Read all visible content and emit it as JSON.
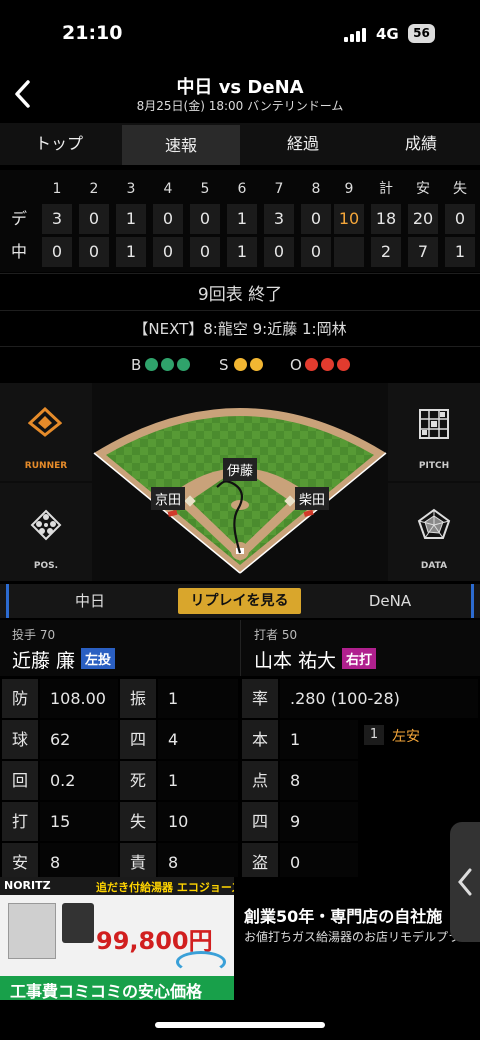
{
  "status": {
    "time": "21:10",
    "network": "4G",
    "battery": "56"
  },
  "header": {
    "title": "中日 vs DeNA",
    "subtitle": "8月25日(金) 18:00 バンテリンドーム"
  },
  "tabs": [
    "トップ",
    "速報",
    "経過",
    "成績"
  ],
  "scoreboard": {
    "headers": [
      "1",
      "2",
      "3",
      "4",
      "5",
      "6",
      "7",
      "8",
      "9",
      "計",
      "安",
      "失"
    ],
    "rows": [
      {
        "team": "デ",
        "cells": [
          "3",
          "0",
          "1",
          "0",
          "0",
          "1",
          "3",
          "0",
          "10",
          "18",
          "20",
          "0"
        ]
      },
      {
        "team": "中",
        "cells": [
          "0",
          "0",
          "1",
          "0",
          "0",
          "1",
          "0",
          "0",
          "",
          "2",
          "7",
          "1"
        ]
      }
    ]
  },
  "inning_status": "9回表 終了",
  "next_batters": "【NEXT】8:龍空 9:近藤 1:岡林",
  "bso": {
    "b_label": "B",
    "s_label": "S",
    "o_label": "O",
    "balls": 3,
    "strikes": 2,
    "outs": 3
  },
  "field": {
    "left_panel_top": "RUNNER",
    "left_panel_bottom": "POS.",
    "right_panel_top": "PITCH",
    "right_panel_bottom": "DATA",
    "fielders": {
      "center": "伊藤",
      "left": "京田",
      "right": "柴田"
    }
  },
  "team_bar": {
    "home": "中日",
    "replay": "リプレイを見る",
    "away": "DeNA"
  },
  "pitcher": {
    "tag": "投手  70",
    "name": "近藤 廉",
    "hand": "左投",
    "stats": [
      [
        "防",
        "108.00",
        "振",
        "1"
      ],
      [
        "球",
        "62",
        "四",
        "4"
      ],
      [
        "回",
        "0.2",
        "死",
        "1"
      ],
      [
        "打",
        "15",
        "失",
        "10"
      ],
      [
        "安",
        "8",
        "責",
        "8"
      ]
    ]
  },
  "batter": {
    "tag": "打者  50",
    "name": "山本 祐大",
    "hand": "右打",
    "stats": [
      [
        "率",
        ".280 (100-28)"
      ],
      [
        "本",
        "1"
      ],
      [
        "点",
        "8"
      ],
      [
        "四",
        "9"
      ],
      [
        "盗",
        "0"
      ]
    ],
    "at_bat": {
      "num": "1",
      "result": "左安"
    }
  },
  "ad": {
    "brand": "NORITZ",
    "banner_title": "追だき付給湯器  エコジョーズ",
    "price": "99,800円",
    "footer": "工事費コミコミの安心価格",
    "headline": "創業50年・専門店の自社施",
    "description": "お値打ちガス給湯器のお店リモデルプラス"
  },
  "colors": {
    "ball": "#2fa36b",
    "strike": "#f2b632",
    "out": "#e23b2e",
    "accent": "#f4a63a",
    "replay": "#d9a62c",
    "pitcher_hand": "#2a5fc2",
    "batter_hand": "#b0208e"
  }
}
